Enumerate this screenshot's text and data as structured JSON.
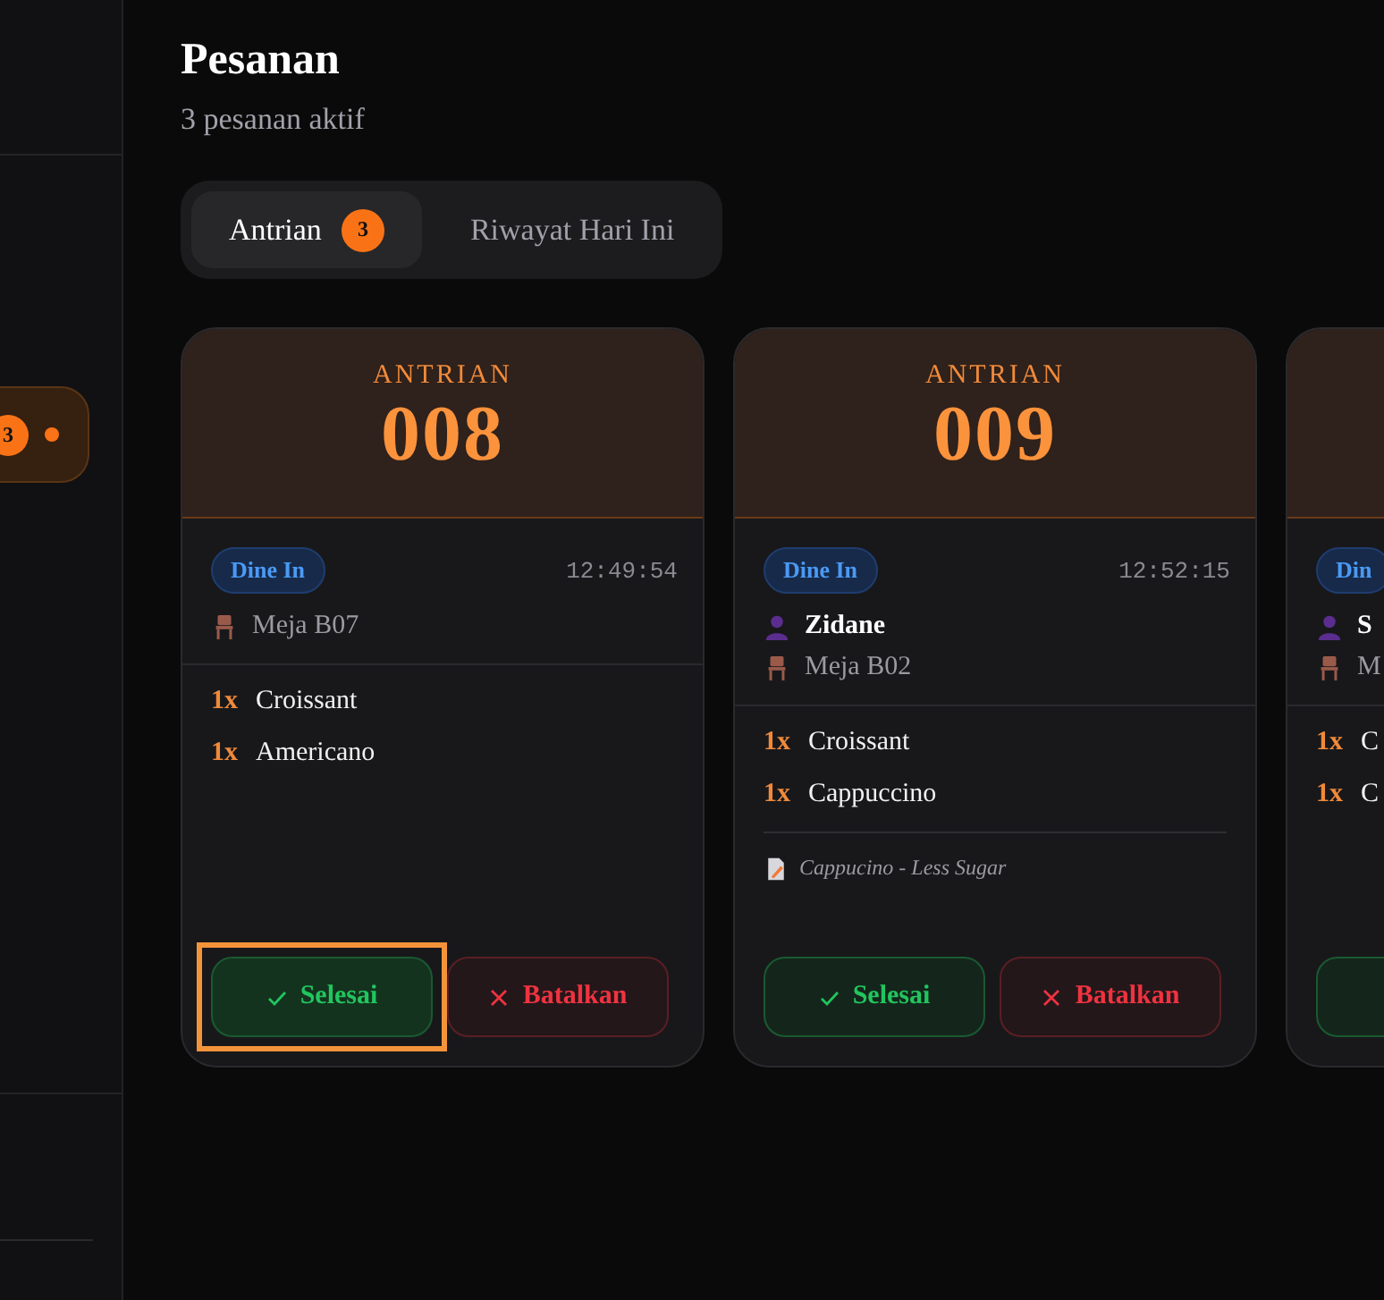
{
  "sidebar": {
    "items": [
      {
        "badge": "3",
        "selected": true
      }
    ]
  },
  "header": {
    "title": "Pesanan",
    "subtitle": "3 pesanan aktif"
  },
  "tabs": [
    {
      "label": "Antrian",
      "badge": "3",
      "selected": true
    },
    {
      "label": "Riwayat Hari Ini",
      "selected": false
    }
  ],
  "orders": [
    {
      "queue_label": "ANTRIAN",
      "number": "008",
      "order_type": "Dine In",
      "time": "12:49:54",
      "table": "Meja B07",
      "items": [
        {
          "qty": "1x",
          "name": "Croissant"
        },
        {
          "qty": "1x",
          "name": "Americano"
        }
      ],
      "buttons": [
        {
          "kind": "done",
          "label": "Selesai",
          "focused": true
        },
        {
          "kind": "cancel",
          "label": "Batalkan",
          "focused": false
        }
      ]
    },
    {
      "queue_label": "ANTRIAN",
      "number": "009",
      "order_type": "Dine In",
      "time": "12:52:15",
      "customer": "Zidane",
      "table": "Meja B02",
      "items": [
        {
          "qty": "1x",
          "name": "Croissant"
        },
        {
          "qty": "1x",
          "name": "Cappuccino"
        }
      ],
      "note": "Cappucino - Less Sugar",
      "buttons": [
        {
          "kind": "done",
          "label": "Selesai",
          "focused": false
        },
        {
          "kind": "cancel",
          "label": "Batalkan",
          "focused": false
        }
      ]
    },
    {
      "order_type": "Din",
      "customer": "S",
      "table": "M",
      "items": [
        {
          "qty": "1x",
          "name": "C"
        },
        {
          "qty": "1x",
          "name": "C"
        }
      ],
      "buttons": [
        {
          "kind": "done",
          "focused": false
        }
      ]
    }
  ]
}
